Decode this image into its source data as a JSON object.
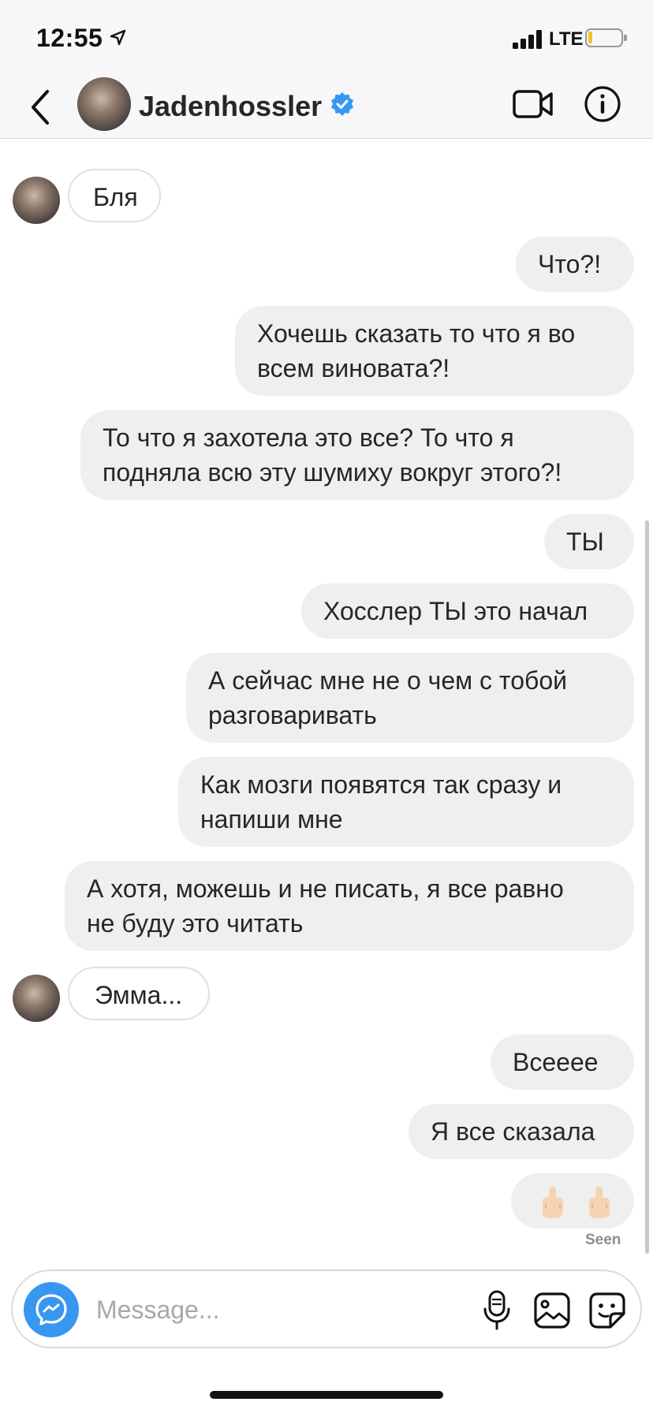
{
  "status_bar": {
    "time": "12:55",
    "network": "LTE",
    "icons": [
      "location-arrow-icon",
      "signal-bars-icon",
      "battery-icon"
    ],
    "battery_level": 0.12,
    "battery_color": "#f2c12e"
  },
  "header": {
    "username": "Jadenhossler",
    "verified": true,
    "icons": [
      "back-chevron-icon",
      "avatar",
      "verified-badge-icon",
      "video-call-icon",
      "info-icon"
    ],
    "verified_color": "#3897f0"
  },
  "messages": [
    {
      "side": "in",
      "text": "Бля"
    },
    {
      "side": "out",
      "text": "Что?!"
    },
    {
      "side": "out",
      "lines": [
        "Хочешь сказать то что я во",
        "всем виновата?!"
      ]
    },
    {
      "side": "out",
      "lines": [
        "То что я захотела это все? То что я",
        "подняла всю эту шумиху вокруг этого?!"
      ]
    },
    {
      "side": "out",
      "text": "ТЫ"
    },
    {
      "side": "out",
      "text": "Хосслер ТЫ это начал"
    },
    {
      "side": "out",
      "lines": [
        "А сейчас мне не о чем с тобой",
        "разговаривать"
      ]
    },
    {
      "side": "out",
      "lines": [
        "Как мозги появятся так сразу и",
        "напиши мне"
      ]
    },
    {
      "side": "out",
      "lines": [
        "А хотя, можешь и не писать, я все равно",
        "не буду это читать"
      ]
    },
    {
      "side": "in",
      "text": "Эмма..."
    },
    {
      "side": "out",
      "text": "Всееее"
    },
    {
      "side": "out",
      "text": "Я все сказала"
    },
    {
      "side": "out",
      "emoji": [
        "middle-finger-emoji",
        "middle-finger-emoji"
      ]
    }
  ],
  "seen_label": "Seen",
  "composer": {
    "placeholder": "Message...",
    "icons": [
      "camera-icon",
      "microphone-icon",
      "gallery-icon",
      "sticker-icon"
    ],
    "accent_color": "#3897f0"
  },
  "colors": {
    "outgoing_bubble": "#efefef",
    "incoming_border": "#e0e0e3",
    "text": "#262626"
  }
}
